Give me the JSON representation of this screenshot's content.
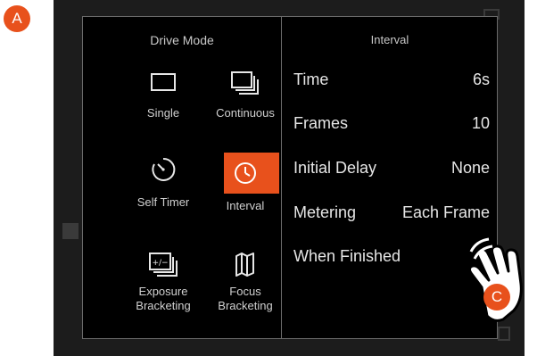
{
  "callout_a": "A",
  "callout_c": "C",
  "drive_mode": {
    "title": "Drive Mode",
    "modes": [
      {
        "label": "Single",
        "icon": "single-frame-icon",
        "active": false
      },
      {
        "label": "Continuous",
        "icon": "continuous-frames-icon",
        "active": false
      },
      {
        "label": "Self Timer",
        "icon": "self-timer-icon",
        "active": false
      },
      {
        "label": "Interval",
        "icon": "interval-clock-icon",
        "active": true
      },
      {
        "label": "Exposure\nBracketing",
        "icon": "exposure-bracketing-icon",
        "active": false
      },
      {
        "label": "Focus\nBracketing",
        "icon": "focus-bracketing-icon",
        "active": false
      }
    ]
  },
  "interval": {
    "title": "Interval",
    "rows": [
      {
        "label": "Time",
        "value": "6s"
      },
      {
        "label": "Frames",
        "value": "10"
      },
      {
        "label": "Initial Delay",
        "value": "None"
      },
      {
        "label": "Metering",
        "value": "Each Frame"
      },
      {
        "label": "When Finished",
        "value": ""
      }
    ]
  },
  "colors": {
    "accent": "#e8511c",
    "panel_bg": "#000000",
    "text": "#e6e6e6"
  }
}
